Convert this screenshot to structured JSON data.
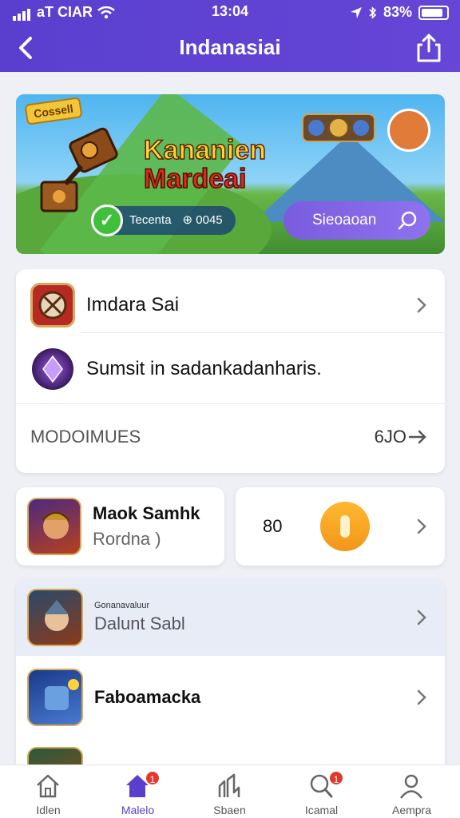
{
  "status_bar": {
    "carrier": "aT CIAR",
    "time": "13:04",
    "battery": "83%"
  },
  "nav": {
    "title": "Indanasiai"
  },
  "banner": {
    "tag": "Cossell",
    "title_line1": "Kananien",
    "title_line2": "Mardeai",
    "stat_1": "Tecenta",
    "stat_2": "⊕ 0045",
    "button_label": "Sieoaoan"
  },
  "card1": {
    "item_1": "Imdara Sai",
    "item_2": "Sumsit in sadankadanharis.",
    "section_label": "MODOIMUES",
    "section_value": "6JO"
  },
  "card2": {
    "title": "Maok Samhk",
    "subtitle": "Rordna )",
    "value": "80"
  },
  "list": {
    "item_1_caption": "Gonanavaluur",
    "item_1_title": "Dalunt Sabl",
    "item_2_title": "Faboamacka"
  },
  "tabs": [
    {
      "label": "Idlen",
      "icon": "home-outline-icon",
      "active": false,
      "badge": ""
    },
    {
      "label": "Malelo",
      "icon": "home-filled-icon",
      "active": true,
      "badge": "1"
    },
    {
      "label": "Sbaen",
      "icon": "chart-icon",
      "active": false,
      "badge": ""
    },
    {
      "label": "Icamal",
      "icon": "search-icon",
      "active": false,
      "badge": "1"
    },
    {
      "label": "Aempra",
      "icon": "profile-icon",
      "active": false,
      "badge": ""
    }
  ],
  "colors": {
    "accent": "#5a3fcf",
    "badge": "#e03a2e",
    "coin": "#f5a623"
  }
}
